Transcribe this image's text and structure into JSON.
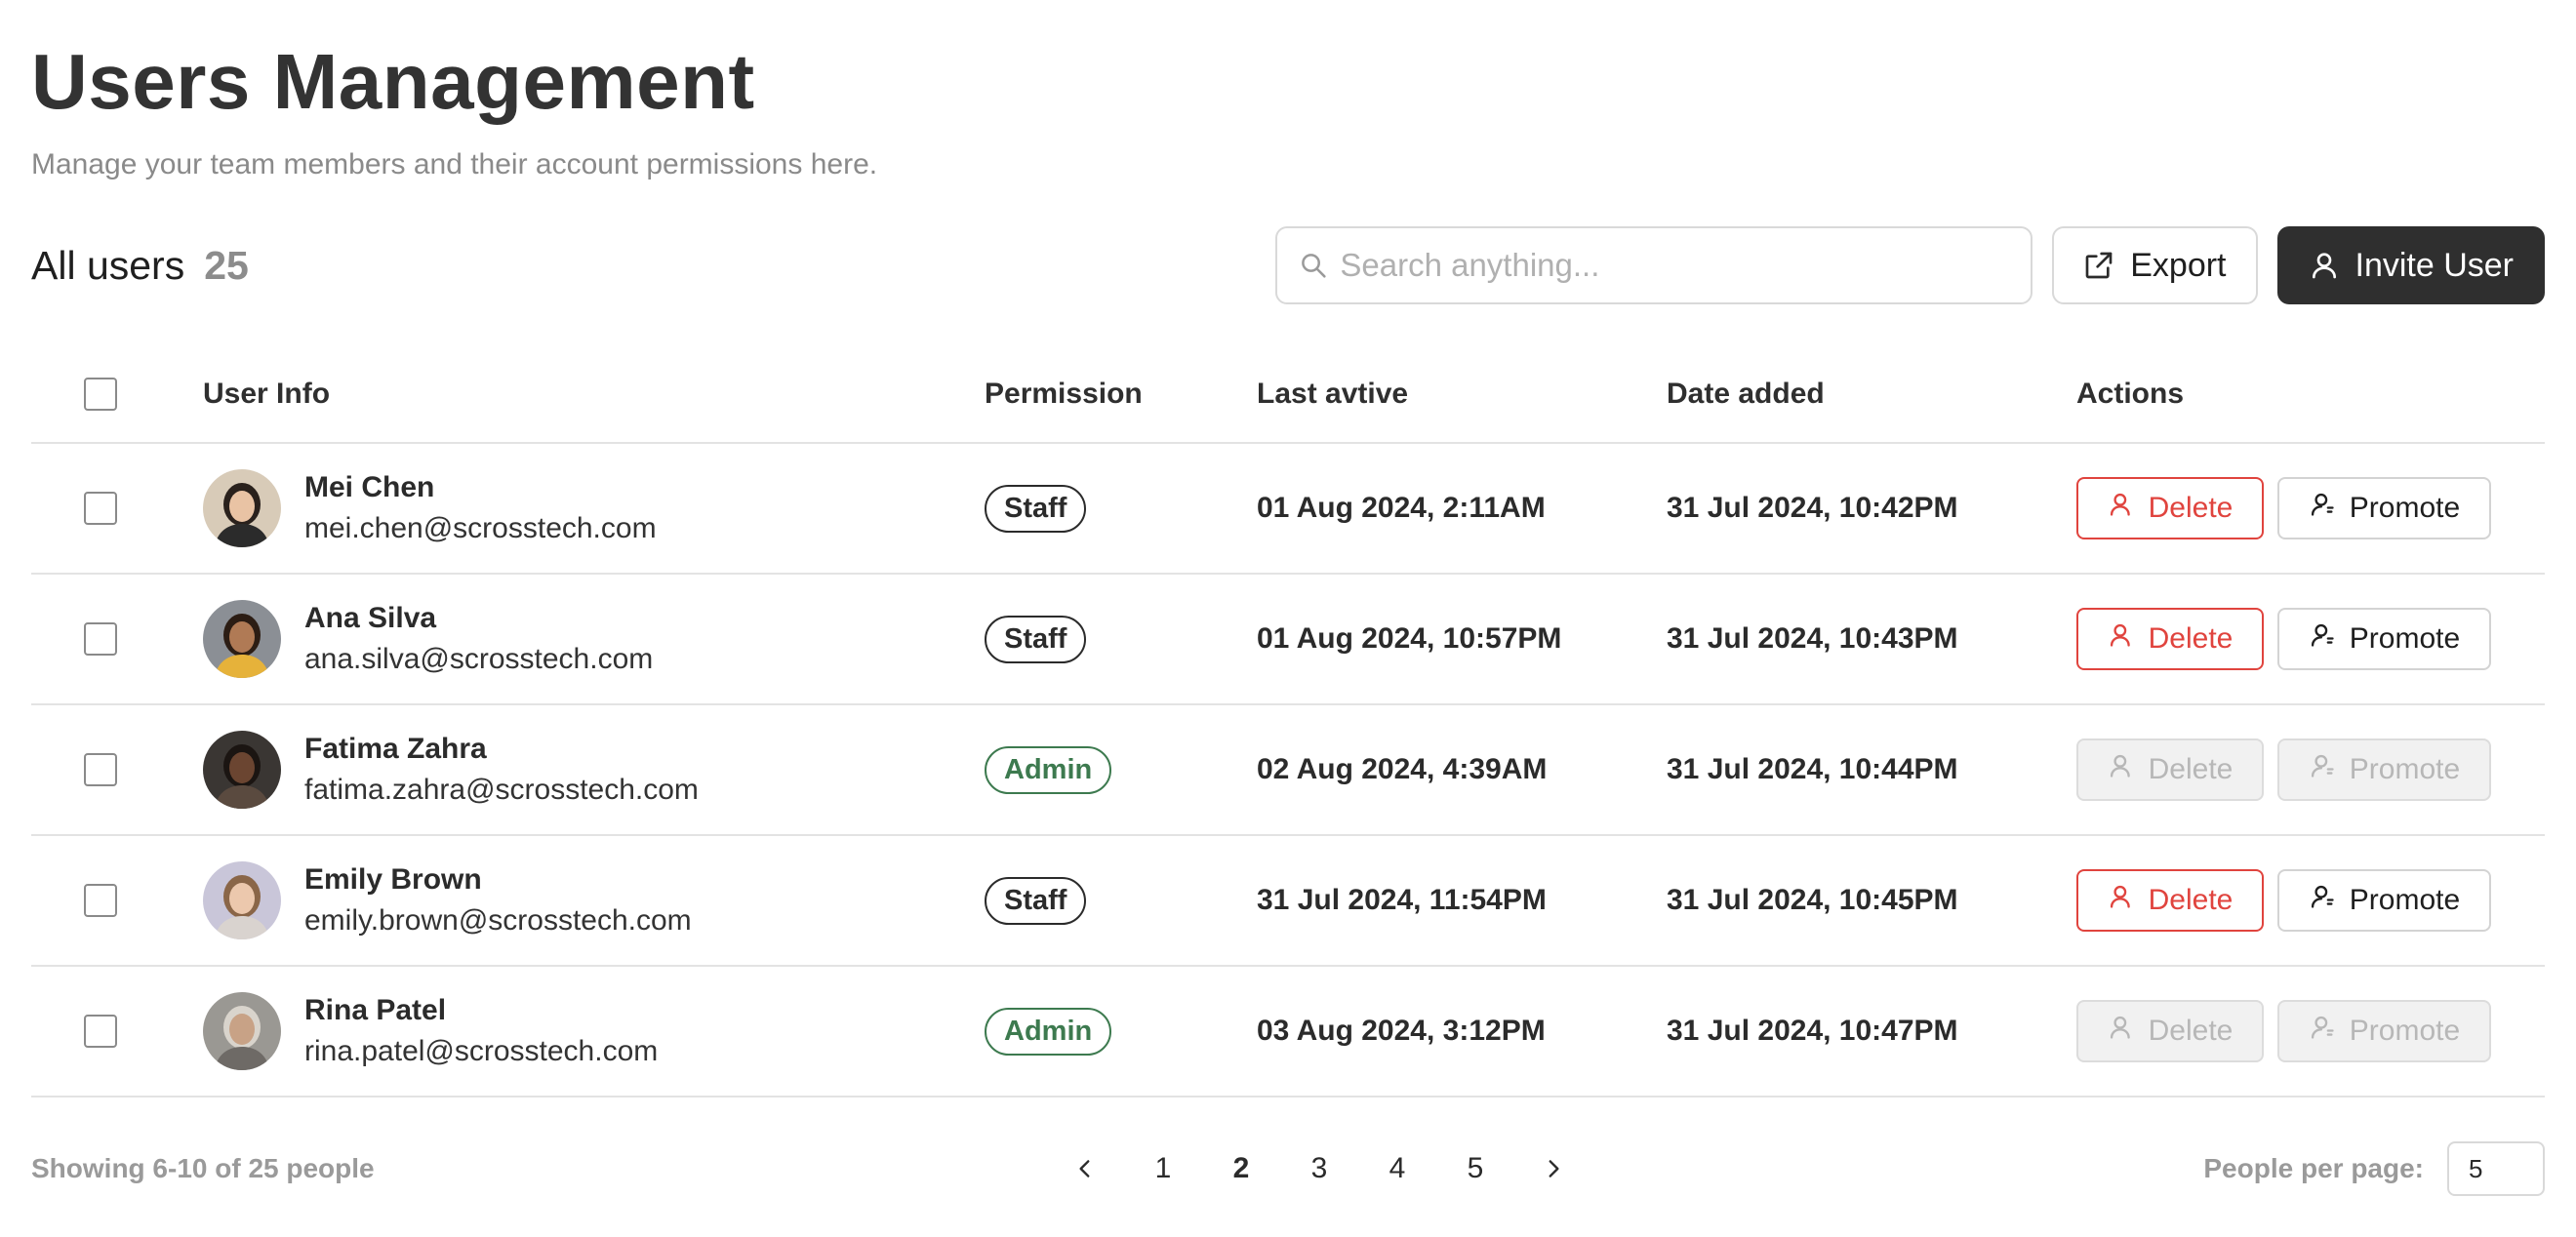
{
  "page": {
    "title": "Users Management",
    "subtitle": "Manage your team members and their account permissions here."
  },
  "toolbar": {
    "all_users_label": "All users",
    "count": "25",
    "search_placeholder": "Search anything...",
    "export_label": "Export",
    "invite_label": "Invite User"
  },
  "table": {
    "headers": {
      "user_info": "User Info",
      "permission": "Permission",
      "last_active": "Last avtive",
      "date_added": "Date added",
      "actions": "Actions"
    },
    "rows": [
      {
        "name": "Mei Chen",
        "email": "mei.chen@scrosstech.com",
        "permission": "Staff",
        "last_active": "01 Aug 2024, 2:11AM",
        "date_added": "31 Jul 2024, 10:42PM",
        "delete_label": "Delete",
        "promote_label": "Promote",
        "actions_enabled": true
      },
      {
        "name": "Ana Silva",
        "email": "ana.silva@scrosstech.com",
        "permission": "Staff",
        "last_active": "01 Aug 2024, 10:57PM",
        "date_added": "31 Jul 2024, 10:43PM",
        "delete_label": "Delete",
        "promote_label": "Promote",
        "actions_enabled": true
      },
      {
        "name": "Fatima Zahra",
        "email": "fatima.zahra@scrosstech.com",
        "permission": "Admin",
        "last_active": "02 Aug 2024, 4:39AM",
        "date_added": "31 Jul 2024, 10:44PM",
        "delete_label": "Delete",
        "promote_label": "Promote",
        "actions_enabled": false
      },
      {
        "name": "Emily Brown",
        "email": "emily.brown@scrosstech.com",
        "permission": "Staff",
        "last_active": "31 Jul 2024, 11:54PM",
        "date_added": "31 Jul 2024, 10:45PM",
        "delete_label": "Delete",
        "promote_label": "Promote",
        "actions_enabled": true
      },
      {
        "name": "Rina Patel",
        "email": "rina.patel@scrosstech.com",
        "permission": "Admin",
        "last_active": "03 Aug 2024, 3:12PM",
        "date_added": "31 Jul 2024, 10:47PM",
        "delete_label": "Delete",
        "promote_label": "Promote",
        "actions_enabled": false
      }
    ]
  },
  "footer": {
    "showing": "Showing 6-10 of 25 people",
    "pages": [
      "1",
      "2",
      "3",
      "4",
      "5"
    ],
    "current_page": "2",
    "per_page_label": "People per page:",
    "per_page_value": "5"
  },
  "colors": {
    "delete": "#e0443e",
    "admin": "#3d7a4f",
    "primary_button": "#2f2f2f"
  },
  "icons": {
    "search": "search-icon",
    "export": "external-link-icon",
    "invite": "user-icon",
    "delete": "user-icon",
    "promote": "user-promote-icon",
    "prev": "chevron-left-icon",
    "next": "chevron-right-icon"
  }
}
